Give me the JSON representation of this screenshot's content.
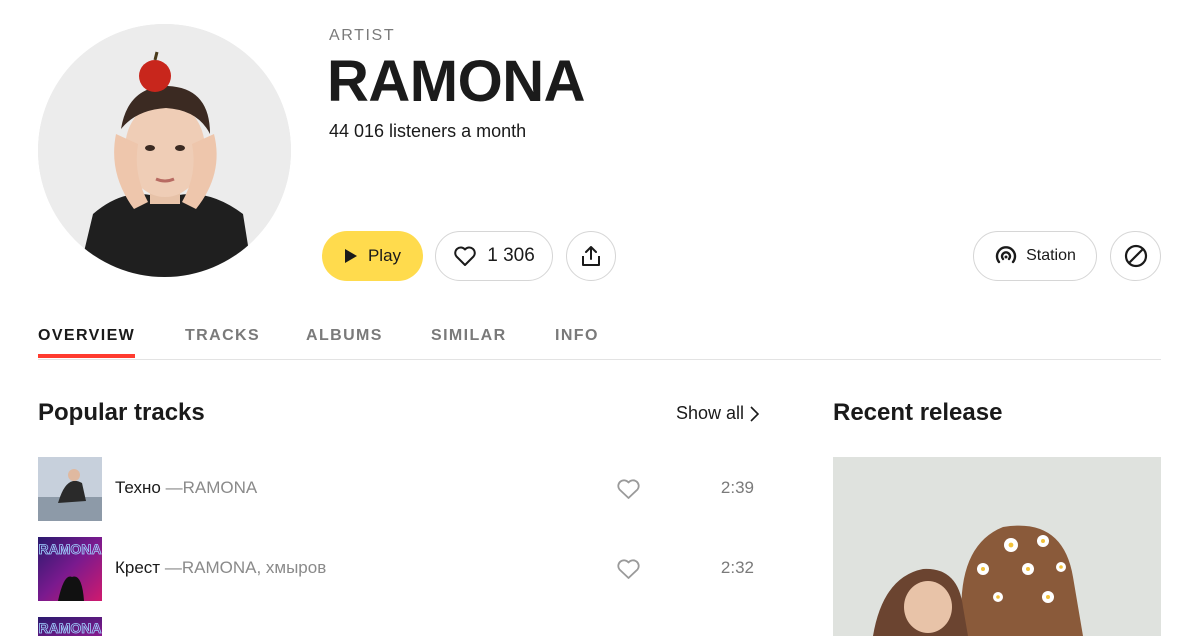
{
  "artist": {
    "kicker": "ARTIST",
    "name": "RAMONA",
    "listeners": "44 016 listeners a month"
  },
  "actions": {
    "play_label": "Play",
    "likes_count": "1 306",
    "station_label": "Station"
  },
  "tabs": [
    {
      "label": "OVERVIEW",
      "active": true
    },
    {
      "label": "TRACKS",
      "active": false
    },
    {
      "label": "ALBUMS",
      "active": false
    },
    {
      "label": "SIMILAR",
      "active": false
    },
    {
      "label": "INFO",
      "active": false
    }
  ],
  "popular": {
    "title": "Popular tracks",
    "show_all": "Show all",
    "tracks": [
      {
        "title": "Техно",
        "separator": "—",
        "artists": "RAMONA",
        "duration": "2:39"
      },
      {
        "title": "Крест",
        "separator": "—",
        "artists": "RAMONA, хмыров",
        "duration": "2:32",
        "cover_text": "RAMONA"
      },
      {
        "cover_text": "RAMONA"
      }
    ]
  },
  "recent": {
    "title": "Recent release"
  },
  "colors": {
    "accent_yellow": "#ffdb4d",
    "tab_underline": "#ff3b2f",
    "muted_text": "#7a7a7a",
    "border": "#d6d6d6"
  }
}
